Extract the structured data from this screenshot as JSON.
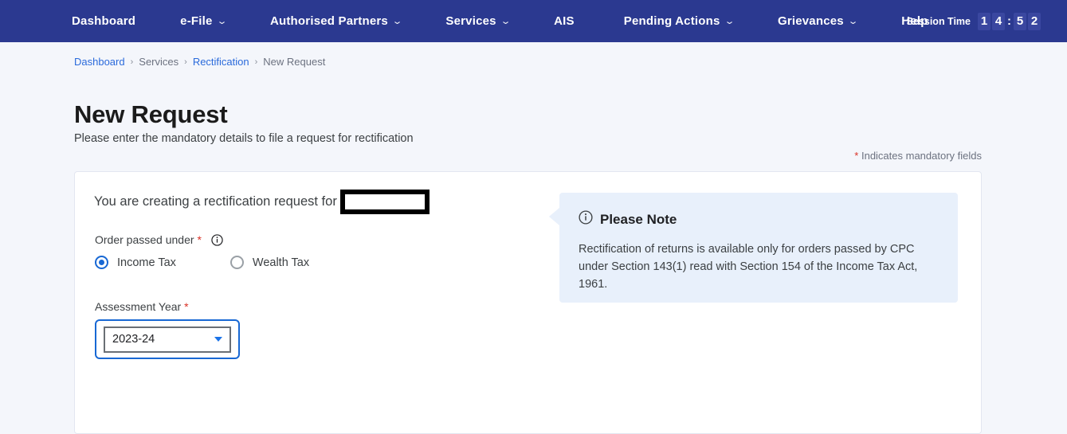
{
  "navbar": {
    "items": [
      {
        "label": "Dashboard",
        "has_caret": false
      },
      {
        "label": "e-File",
        "has_caret": true
      },
      {
        "label": "Authorised Partners",
        "has_caret": true
      },
      {
        "label": "Services",
        "has_caret": true
      },
      {
        "label": "AIS",
        "has_caret": false
      },
      {
        "label": "Pending Actions",
        "has_caret": true
      },
      {
        "label": "Grievances",
        "has_caret": true
      },
      {
        "label": "Help",
        "has_caret": false
      }
    ],
    "caret_glyph": "⌄",
    "session": {
      "label": "Session Time",
      "digits": [
        "1",
        "4",
        "5",
        "2"
      ],
      "separator": ":",
      "time_display": "14:52"
    },
    "bg_color": "#2b3990",
    "digit_bg_color": "#3a47a0"
  },
  "breadcrumb": {
    "separator": "›",
    "items": [
      {
        "label": "Dashboard",
        "is_link": true
      },
      {
        "label": "Services",
        "is_link": false
      },
      {
        "label": "Rectification",
        "is_link": true
      },
      {
        "label": "New Request",
        "is_link": false
      }
    ],
    "link_color": "#2a6adb"
  },
  "header": {
    "title": "New Request",
    "subtitle": "Please enter the mandatory details to file a request for rectification",
    "mandatory_star": "*",
    "mandatory_text": " Indicates mandatory fields",
    "required_color": "#d93025"
  },
  "form": {
    "creating_text": "You are creating a rectification request for",
    "redaction_name": "redacted-pan-box",
    "order_passed_under": {
      "label": "Order passed under",
      "star": "*",
      "info_icon": "info-circle-icon",
      "options": [
        {
          "label": "Income Tax",
          "selected": true
        },
        {
          "label": "Wealth Tax",
          "selected": false
        }
      ]
    },
    "assessment_year": {
      "label": "Assessment Year",
      "star": "*",
      "selected_value": "2023-24",
      "caret_icon": "chevron-down-icon",
      "focus_color": "#1868d4"
    }
  },
  "note": {
    "icon": "info-circle-icon",
    "title": "Please Note",
    "body": "Rectification of returns is available only for orders passed by CPC under Section 143(1) read with Section 154 of the Income Tax Act, 1961.",
    "bg_color": "#e8f0fb"
  }
}
